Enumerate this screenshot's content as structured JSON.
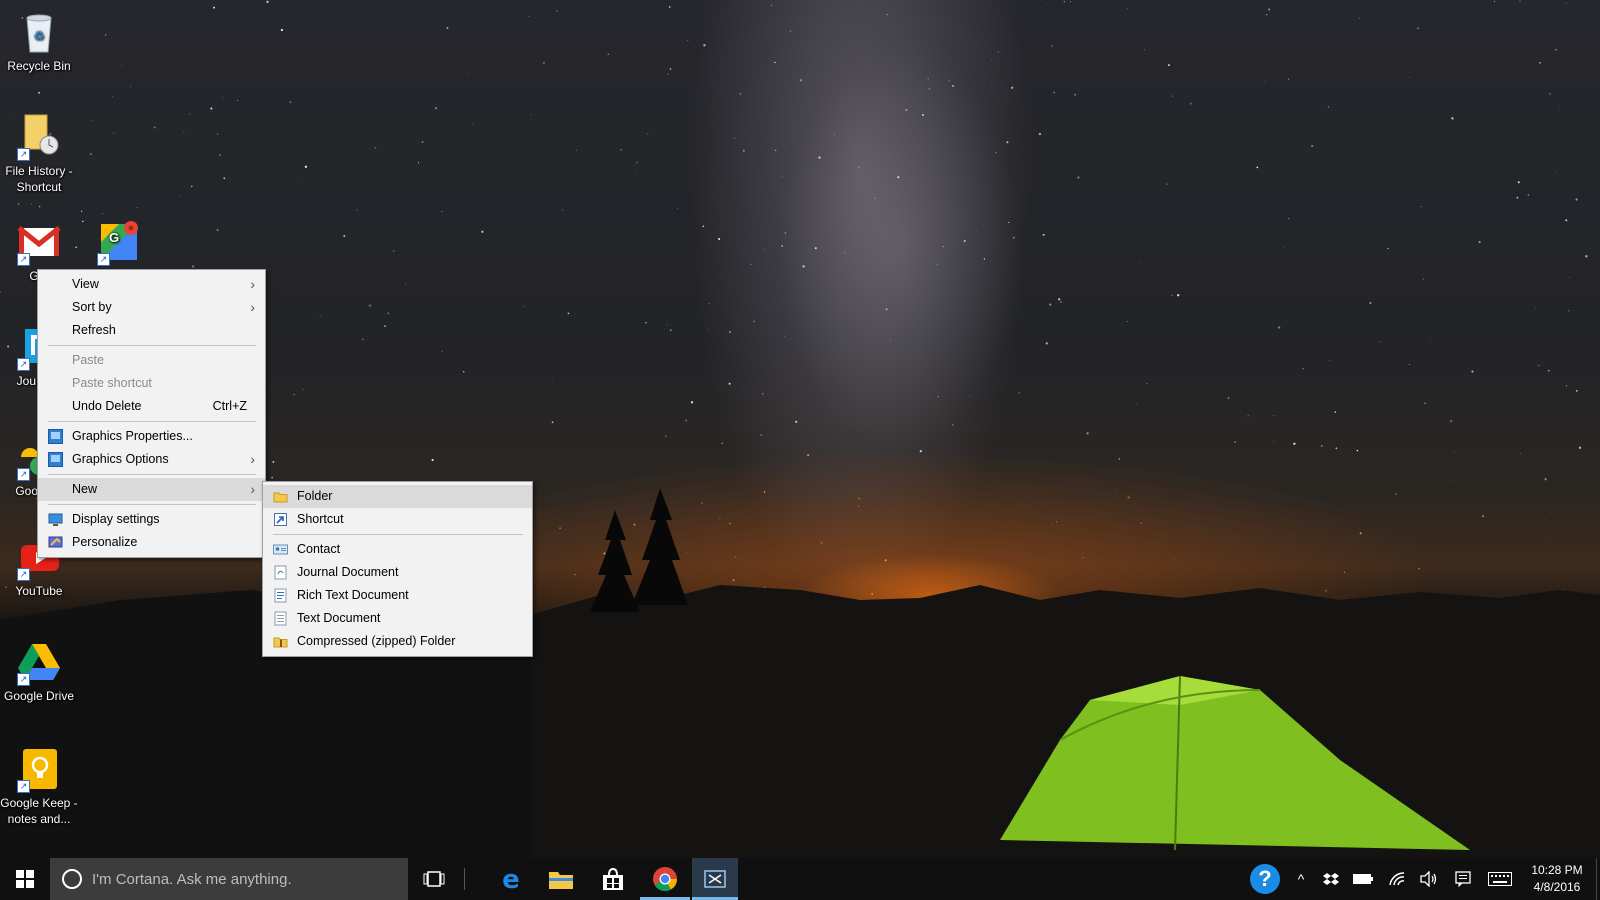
{
  "desktop_icons": [
    {
      "label": "Recycle Bin"
    },
    {
      "label": "File History - Shortcut"
    },
    {
      "label": "Gm"
    },
    {
      "label": "Jou (Dia"
    },
    {
      "label": "Goo Pho"
    },
    {
      "label": "YouTube"
    },
    {
      "label": "Google Drive"
    },
    {
      "label": "Google Keep - notes and..."
    }
  ],
  "context_menu": {
    "items": [
      {
        "label": "View",
        "submenu": true
      },
      {
        "label": "Sort by",
        "submenu": true
      },
      {
        "label": "Refresh"
      },
      {
        "label": "Paste",
        "disabled": true
      },
      {
        "label": "Paste shortcut",
        "disabled": true
      },
      {
        "label": "Undo Delete",
        "shortcut": "Ctrl+Z"
      },
      {
        "label": "Graphics Properties..."
      },
      {
        "label": "Graphics Options",
        "submenu": true
      },
      {
        "label": "New",
        "submenu": true,
        "highlighted": true
      },
      {
        "label": "Display settings"
      },
      {
        "label": "Personalize"
      }
    ]
  },
  "new_submenu": {
    "items": [
      {
        "label": "Folder",
        "highlighted": true
      },
      {
        "label": "Shortcut"
      },
      {
        "label": "Contact"
      },
      {
        "label": "Journal Document"
      },
      {
        "label": "Rich Text Document"
      },
      {
        "label": "Text Document"
      },
      {
        "label": "Compressed (zipped) Folder"
      }
    ]
  },
  "taskbar": {
    "search_placeholder": "I'm Cortana. Ask me anything.",
    "pinned": [
      "task-view",
      "edge",
      "file-explorer",
      "store",
      "chrome",
      "snipping-tool"
    ],
    "time": "10:28 PM",
    "date": "4/8/2016"
  },
  "colors": {
    "taskbar": "#101010",
    "search_box": "#3c3c3c",
    "active_indicator": "#76b9ed",
    "menu_bg": "#f2f2f2",
    "menu_highlight": "#dadada"
  }
}
